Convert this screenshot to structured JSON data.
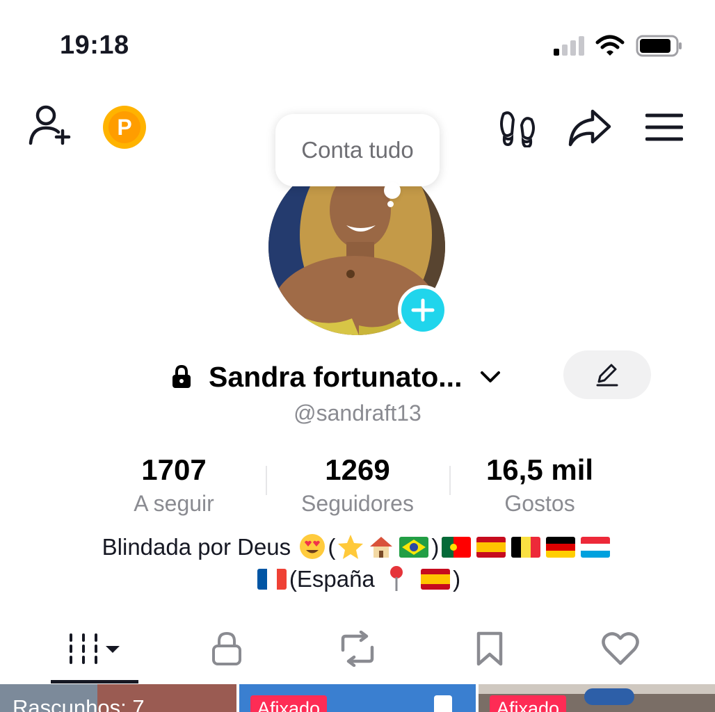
{
  "status_bar": {
    "time": "19:18"
  },
  "tooltip": {
    "text": "Conta tudo"
  },
  "coin": {
    "letter": "P"
  },
  "profile": {
    "display_name": "Sandra fortunato...",
    "username": "@sandraft13"
  },
  "stats": [
    {
      "value": "1707",
      "label": "A seguir"
    },
    {
      "value": "1269",
      "label": "Seguidores"
    },
    {
      "value": "16,5 mil",
      "label": "Gostos"
    }
  ],
  "bio": {
    "line1_text": "Blindada por Deus",
    "line1_open": "(",
    "line1_close": ")",
    "line2_text": "(España",
    "line2_close": ")"
  },
  "tabs": [
    "videos",
    "private",
    "reposts",
    "favorites",
    "liked"
  ],
  "grid": {
    "drafts_label": "Rascunhos: 7",
    "pinned_label_1": "Afixado",
    "pinned_label_2": "Afixado"
  },
  "colors": {
    "accent_cyan": "#20d5ec",
    "pinned_red": "#fe2c55",
    "coin_orange": "#ffb300",
    "muted_text": "#8a8b91"
  },
  "icons": [
    "add-friend-icon",
    "coin-icon",
    "footprint-icon",
    "share-icon",
    "menu-icon",
    "lock-icon",
    "chevron-down-icon",
    "edit-pencil-icon",
    "plus-icon"
  ]
}
